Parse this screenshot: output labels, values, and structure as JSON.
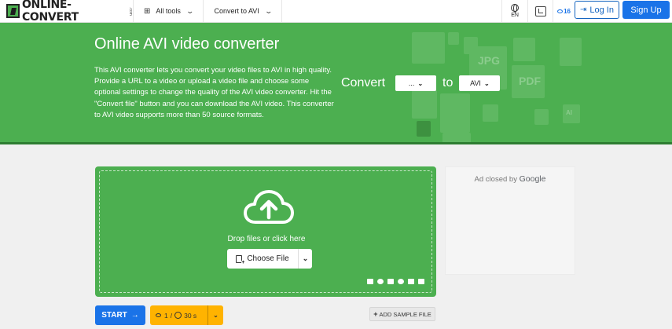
{
  "header": {
    "logo_text": "ONLINE-CONVERT",
    "logo_suffix": ".com",
    "nav": [
      {
        "label": "All tools",
        "icon": "grid-icon"
      },
      {
        "label": "Convert to AVI"
      }
    ],
    "language": "EN",
    "credits": "16",
    "login_label": "Log In",
    "signup_label": "Sign Up"
  },
  "hero": {
    "title": "Online AVI video converter",
    "description": "This AVI converter lets you convert your video files to AVI in high quality. Provide a URL to a video or upload a video file and choose some optional settings to change the quality of the AVI video converter. Hit the \"Convert file\" button and you can download the AVI video. This converter to AVI video supports more than 50 source formats.",
    "convert_label": "Convert",
    "from_value": "...",
    "to_label": "to",
    "to_value": "AVI",
    "deco_labels": [
      "JPG",
      "PDF",
      "AI"
    ]
  },
  "upload": {
    "drop_text": "Drop files or click here",
    "choose_label": "Choose File",
    "source_icons": [
      "folder-icon",
      "link-icon",
      "google-drive-icon",
      "onedrive-icon",
      "dropbox-icon",
      "clipboard-icon"
    ]
  },
  "ad": {
    "text": "Ad closed by",
    "brand": "Google"
  },
  "actions": {
    "start_label": "START",
    "limit_files": "1",
    "limit_sep": "/",
    "limit_time": "30 s",
    "sample_label": "ADD SAMPLE FILE"
  },
  "colors": {
    "hero_green": "#4caf50",
    "primary_blue": "#1a73e8",
    "limit_orange": "#ffb300"
  }
}
